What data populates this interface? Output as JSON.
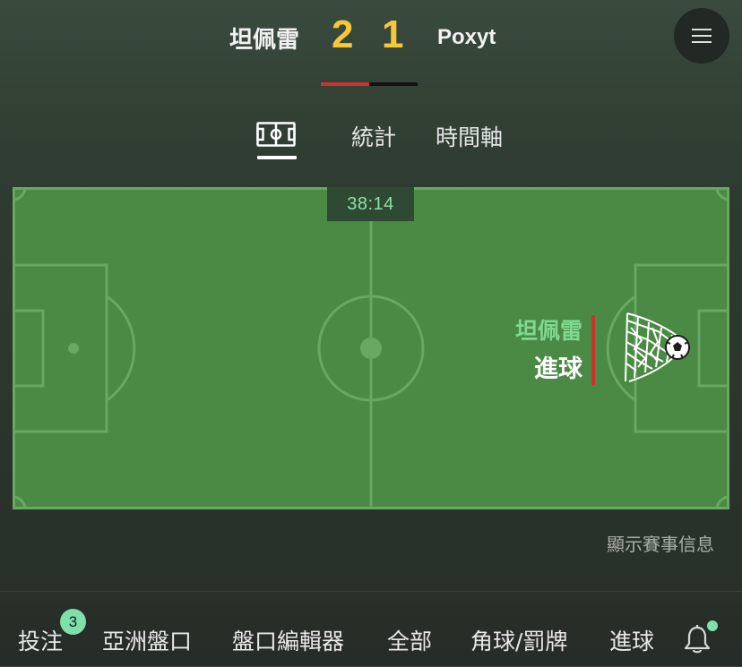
{
  "scoreboard": {
    "home_team": "坦佩雷",
    "away_team": "Poxyt",
    "home_score": "2",
    "away_score": "1",
    "possession_home_fraction": 0.5
  },
  "tabs": [
    {
      "icon": "pitch-icon",
      "active": true
    },
    {
      "label": "統計"
    },
    {
      "label": "時間軸"
    }
  ],
  "pitch": {
    "clock": "38:14",
    "event_team": "坦佩雷",
    "event_type": "進球",
    "event_icon": "goal-net-ball-icon"
  },
  "show_info_link": "顯示賽事信息",
  "bottom_nav": {
    "items": [
      "投注",
      "亞洲盤口",
      "盤口編輯器",
      "全部",
      "角球/罰牌",
      "進球"
    ],
    "bet_badge": "3",
    "bell_icon": "bell-icon"
  },
  "colors": {
    "score": "#f5c83a",
    "pitch": "#4a8a44",
    "event_team": "#7fd990",
    "accent_red": "#c9342c",
    "badge": "#7fe0ac"
  }
}
